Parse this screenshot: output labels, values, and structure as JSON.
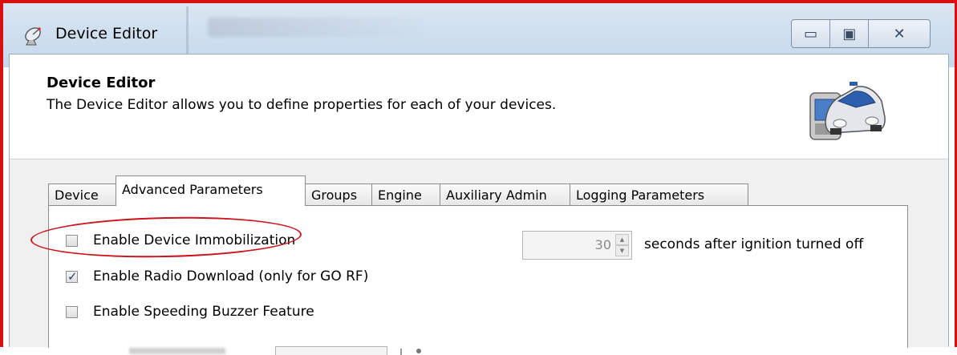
{
  "window": {
    "title": "Device Editor",
    "controls": {
      "minimize": "▭",
      "maximize": "▣",
      "close": "✕"
    }
  },
  "header": {
    "title": "Device Editor",
    "description": "The Device Editor allows you to define properties for each of your devices."
  },
  "tabs": [
    {
      "label": "Device",
      "active": false
    },
    {
      "label": "Advanced Parameters",
      "active": true
    },
    {
      "label": "Groups",
      "active": false
    },
    {
      "label": "Engine",
      "active": false
    },
    {
      "label": "Auxiliary Admin",
      "active": false
    },
    {
      "label": "Logging Parameters",
      "active": false
    }
  ],
  "advanced": {
    "immobilization": {
      "label": "Enable Device Immobilization",
      "checked": false
    },
    "radio_download": {
      "label": "Enable Radio Download (only for GO RF)",
      "checked": true
    },
    "speeding_buzzer": {
      "label": "Enable Speeding Buzzer Feature",
      "checked": false
    },
    "immobilization_delay": {
      "value": "30",
      "suffix": "seconds after ignition turned off"
    }
  },
  "annotation": {
    "color": "#c9161c"
  }
}
